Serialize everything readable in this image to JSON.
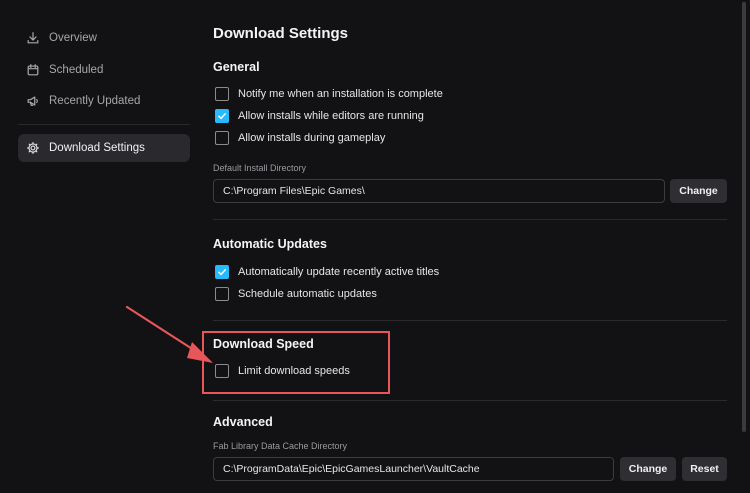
{
  "sidebar": {
    "items": [
      {
        "label": "Overview",
        "icon": "download-icon"
      },
      {
        "label": "Scheduled",
        "icon": "calendar-icon"
      },
      {
        "label": "Recently Updated",
        "icon": "megaphone-icon"
      },
      {
        "label": "Download Settings",
        "icon": "gear-icon",
        "active": true
      }
    ]
  },
  "main": {
    "title": "Download Settings",
    "general": {
      "title": "General",
      "options": [
        {
          "label": "Notify me when an installation is complete",
          "checked": false
        },
        {
          "label": "Allow installs while editors are running",
          "checked": true
        },
        {
          "label": "Allow installs during gameplay",
          "checked": false
        }
      ],
      "install_dir_label": "Default Install Directory",
      "install_dir_value": "C:\\Program Files\\Epic Games\\",
      "change_label": "Change"
    },
    "automatic_updates": {
      "title": "Automatic Updates",
      "options": [
        {
          "label": "Automatically update recently active titles",
          "checked": true
        },
        {
          "label": "Schedule automatic updates",
          "checked": false
        }
      ]
    },
    "download_speed": {
      "title": "Download Speed",
      "options": [
        {
          "label": "Limit download speeds",
          "checked": false
        }
      ]
    },
    "advanced": {
      "title": "Advanced",
      "cache_dir_label": "Fab Library Data Cache Directory",
      "cache_dir_value": "C:\\ProgramData\\Epic\\EpicGamesLauncher\\VaultCache",
      "change_label": "Change",
      "reset_label": "Reset"
    }
  },
  "colors": {
    "accent": "#26bbff",
    "background": "#121214",
    "annotation": "#e8565a"
  }
}
